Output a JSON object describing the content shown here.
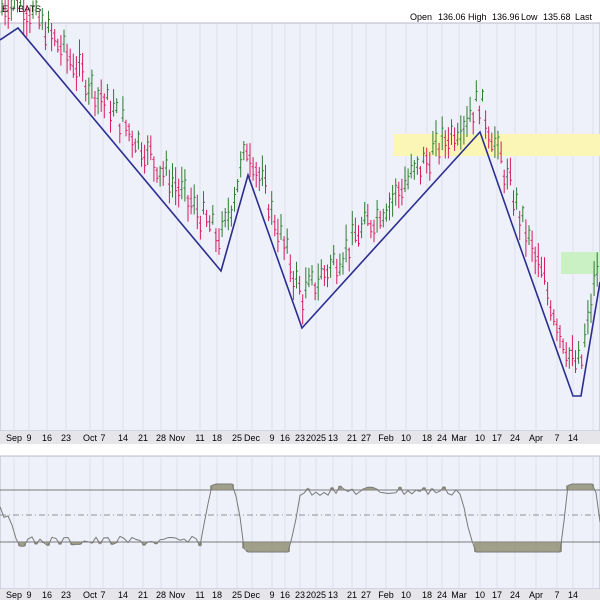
{
  "header": {
    "title_fragment": "E + BATS",
    "open_label": "Open",
    "open_value": "136.06",
    "high_label": "High",
    "high_value": "136.96",
    "low_label": "Low",
    "low_value": "135.68",
    "last_label": "Last"
  },
  "colors": {
    "background": "#ffffff",
    "plot_background": "#eef0fa",
    "up_bar": "#2e7d32",
    "down_bar": "#d81b60",
    "zigzag": "#2b2e8f",
    "resistance_zone": "#fbf6b5",
    "support_zone": "#c9f1c4",
    "oscillator_line": "#7a7a7a",
    "oscillator_fill": "#8c8c6e"
  },
  "chart_data": [
    {
      "type": "ohlc",
      "name": "price",
      "x": [
        "Sep 9",
        "Sep 16",
        "Sep 23",
        "Oct 7",
        "Oct 14",
        "Oct 21",
        "Oct 28",
        "Nov 11",
        "Nov 18",
        "Nov 25",
        "Dec 9",
        "Dec 16",
        "Dec 23",
        "2025",
        "Jan 13",
        "Jan 21",
        "Jan 27",
        "Feb 10",
        "Feb 18",
        "Feb 24",
        "Mar 10",
        "Mar 17",
        "Mar 24",
        "Apr 7",
        "Apr 14"
      ],
      "tick_labels": [
        "Sep",
        "9",
        "16",
        "23",
        "Oct",
        "7",
        "14",
        "21",
        "28",
        "Nov",
        "11",
        "18",
        "25",
        "Dec",
        "9",
        "16",
        "23",
        "2025",
        "13",
        "21",
        "27",
        "Feb",
        "10",
        "18",
        "24",
        "Mar",
        "10",
        "17",
        "24",
        "Apr",
        "7",
        "14"
      ],
      "series": [
        {
          "role": "zigzag",
          "points_rel": [
            [
              0.0,
              0.82
            ],
            [
              0.03,
              1.0
            ],
            [
              0.37,
              0.25
            ],
            [
              0.41,
              0.55
            ],
            [
              0.5,
              0.0
            ],
            [
              0.8,
              0.72
            ],
            [
              0.85,
              0.4
            ],
            [
              0.955,
              -0.55
            ],
            [
              0.965,
              -0.55
            ],
            [
              1.0,
              0.2
            ]
          ]
        }
      ],
      "zones": [
        {
          "role": "resistance",
          "color": "#fbf6b5"
        },
        {
          "role": "support",
          "color": "#c9f1c4"
        }
      ],
      "grid": true
    },
    {
      "type": "line",
      "name": "oscillator",
      "reference_lines": [
        "upper",
        "middle",
        "lower"
      ],
      "grid": true
    }
  ]
}
